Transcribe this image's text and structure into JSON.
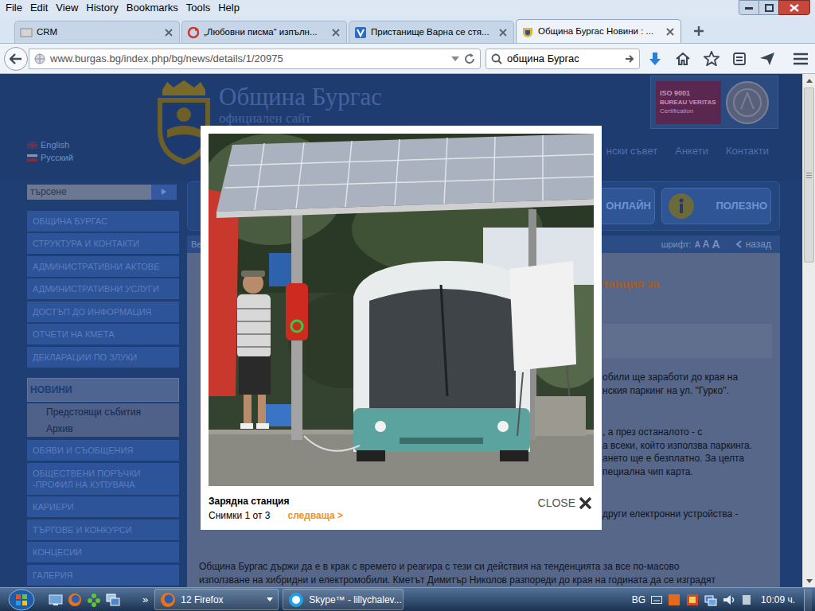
{
  "window": {
    "menu": [
      "File",
      "Edit",
      "View",
      "History",
      "Bookmarks",
      "Tools",
      "Help"
    ]
  },
  "tabs": [
    {
      "label": "CRM",
      "selected": false
    },
    {
      "label": "„Любовни писма“ изпълн...",
      "selected": false
    },
    {
      "label": "Пристанище Варна се стя...",
      "selected": false
    },
    {
      "label": "Община Бургас Новини : ...",
      "selected": true
    }
  ],
  "navbar": {
    "url": "www.burgas.bg/index.php/bg/news/details/1/20975",
    "search": "община Бургас"
  },
  "page": {
    "languages": [
      "English",
      "Русский"
    ],
    "site_title": "Община Бургас",
    "site_subtitle": "официален сайт",
    "certificate": {
      "standard": "ISO 9001",
      "body": "BUREAU VERITAS",
      "label": "Certification"
    },
    "search_placeholder": "търсене",
    "top_links": [
      "нски съвет",
      "Анкети",
      "Контакти"
    ],
    "quick_links": [
      "ОНЛАЙН",
      "ПОЛЕЗНО"
    ],
    "breadcrumb": "Ве",
    "font_label": "шрифт:",
    "font_sizes": [
      "A",
      "A",
      "A"
    ],
    "back": "назад",
    "sidebar": [
      {
        "label": "ОБЩИНА БУРГАС",
        "kind": "main",
        "selected": false
      },
      {
        "label": "СТРУКТУРА И КОНТАКТИ",
        "kind": "main",
        "selected": false
      },
      {
        "label": "АДМИНИСТРАТИВНИ АКТОВЕ",
        "kind": "main",
        "selected": false
      },
      {
        "label": "АДМИНИСТРАТИВНИ УСЛУГИ",
        "kind": "main",
        "selected": false
      },
      {
        "label": "ДОСТЪП ДО ИНФОРМАЦИЯ",
        "kind": "main",
        "selected": false
      },
      {
        "label": "ОТЧЕТИ НА КМЕТА",
        "kind": "main",
        "selected": false
      },
      {
        "label": "ДЕКЛАРАЦИИ ПО ЗЛУКИ",
        "kind": "main",
        "selected": false
      },
      {
        "label": "НОВИНИ",
        "kind": "main",
        "selected": true
      },
      {
        "label": "Предстоящи събития",
        "kind": "sub",
        "selected": false
      },
      {
        "label": "Архив",
        "kind": "sub",
        "selected": false
      },
      {
        "label": "ОБЯВИ И СЪОБЩЕНИЯ",
        "kind": "main",
        "selected": false
      },
      {
        "label": "ОБЩЕСТВЕНИ ПОРЪЧКИ -ПРОФИЛ НА КУПУВАЧА",
        "kind": "main",
        "selected": false
      },
      {
        "label": "КАРИЕРИ",
        "kind": "main",
        "selected": false
      },
      {
        "label": "ТЪРГОВЕ И КОНКУРСИ",
        "kind": "main",
        "selected": false
      },
      {
        "label": "КОНЦЕСИИ",
        "kind": "main",
        "selected": false
      },
      {
        "label": "ГАЛЕРИЯ",
        "kind": "main",
        "selected": false
      }
    ],
    "article": {
      "title": "танция за",
      "paragraphs": [
        [
          "обили ще заработи до края на",
          "нския паркинг на ул. \"Гурко\"."
        ],
        [
          ", а през останалото - с",
          "а всеки, който използва паркинга.",
          "ането ще е безплатно. За целта",
          "пециална чип карта."
        ],
        [
          "други електронни устройства -"
        ]
      ],
      "lines": [
        "Община Бургас държи да е в крак с времето и реагира с тези си действия на тенденцията за все по-масово",
        "използване на хибридни и електромобили. Кметът Димитър Николов разпореди до края на годината да се изградят"
      ]
    }
  },
  "lightbox": {
    "caption": "Зарядна станция",
    "counter": "Снимки 1 от 3",
    "next": "следваща >",
    "close": "CLOSE"
  },
  "taskbar": {
    "overflow": "»",
    "buttons": [
      {
        "label": "12 Firefox",
        "selected": false
      },
      {
        "label": "Skype™ - lillychalev...",
        "selected": false
      }
    ],
    "language": "BG",
    "clock": "10:09 ч."
  }
}
